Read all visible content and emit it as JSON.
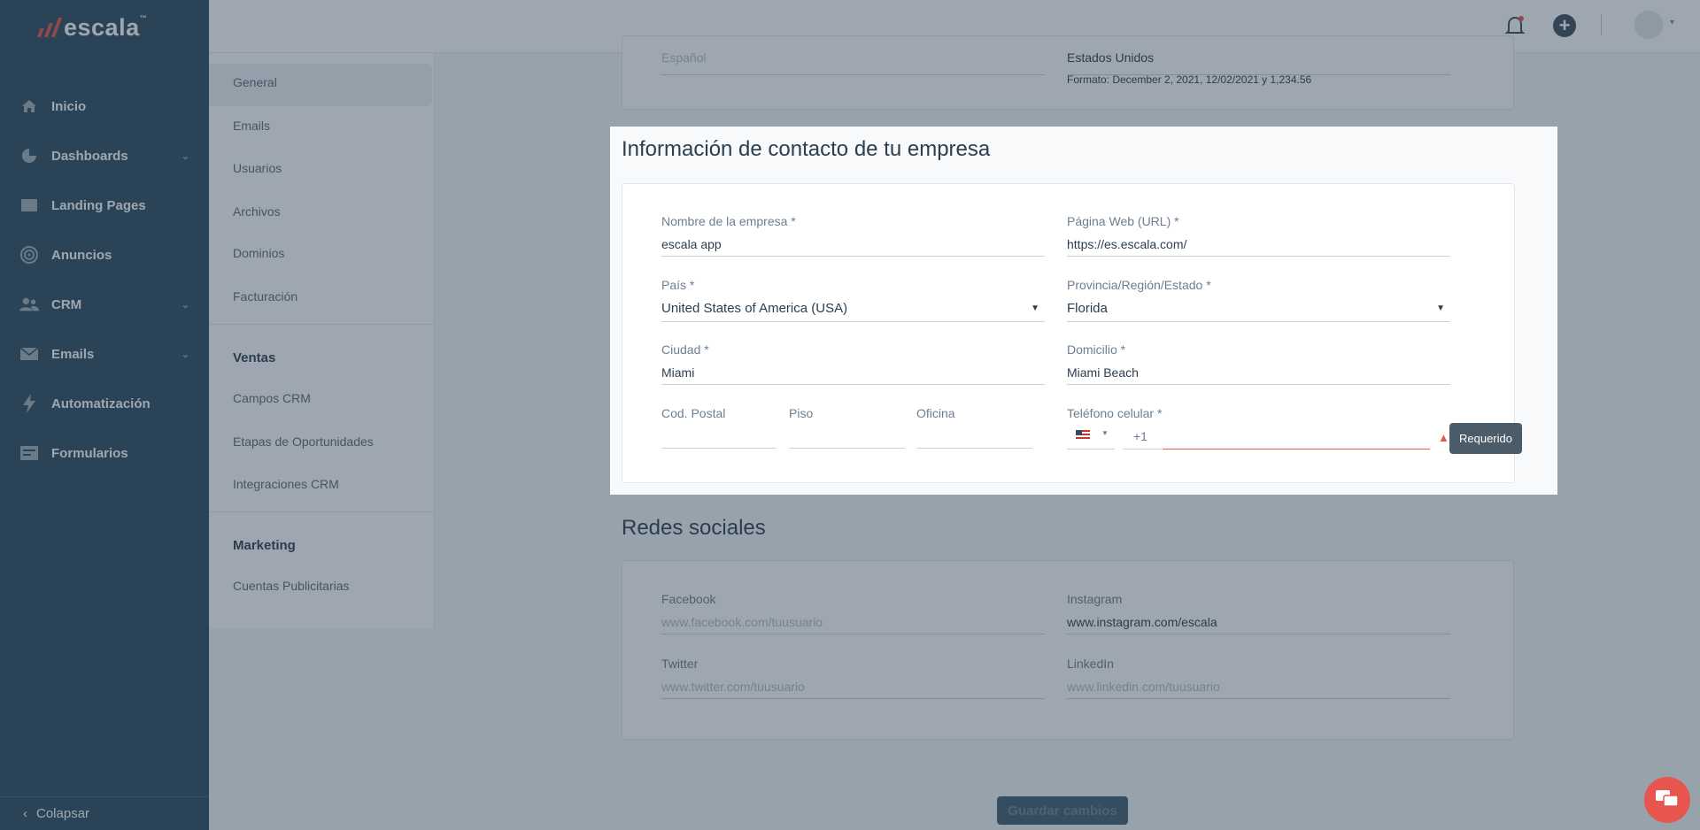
{
  "app": {
    "brand": "escala",
    "brand_tm": "™"
  },
  "sidebar": {
    "items": [
      {
        "label": "Inicio",
        "icon": "home-icon"
      },
      {
        "label": "Dashboards",
        "icon": "pie-chart-icon",
        "has_chevron": true
      },
      {
        "label": "Landing Pages",
        "icon": "browser-icon"
      },
      {
        "label": "Anuncios",
        "icon": "target-icon"
      },
      {
        "label": "CRM",
        "icon": "users-icon",
        "has_chevron": true
      },
      {
        "label": "Emails",
        "icon": "envelope-icon",
        "has_chevron": true
      },
      {
        "label": "Automatización",
        "icon": "bolt-icon"
      },
      {
        "label": "Formularios",
        "icon": "form-icon"
      }
    ],
    "collapse_label": "Colapsar"
  },
  "subnav": {
    "general": [
      "General",
      "Emails",
      "Usuarios",
      "Archivos",
      "Dominios",
      "Facturación"
    ],
    "ventas_heading": "Ventas",
    "ventas": [
      "Campos CRM",
      "Etapas de Oportunidades",
      "Integraciones CRM"
    ],
    "marketing_heading": "Marketing",
    "marketing": [
      "Cuentas Publicitarias"
    ]
  },
  "top_card": {
    "language_value": "Español",
    "country_value": "Estados Unidos",
    "format_note": "Formato: December 2, 2021, 12/02/2021 y 1,234.56"
  },
  "contact": {
    "title": "Información de contacto de tu empresa",
    "company_label": "Nombre de la empresa *",
    "company_value": "escala app",
    "web_label": "Página Web (URL) *",
    "web_value": "https://es.escala.com/",
    "country_label": "País *",
    "country_value": "United States of America (USA)",
    "region_label": "Provincia/Región/Estado *",
    "region_value": "Florida",
    "city_label": "Ciudad *",
    "city_value": "Miami",
    "address_label": "Domicilio *",
    "address_value": "Miami Beach",
    "postal_label": "Cod. Postal",
    "floor_label": "Piso",
    "office_label": "Oficina",
    "phone_label": "Teléfono celular *",
    "phone_code": "+1",
    "tooltip": "Requerido"
  },
  "social": {
    "title": "Redes sociales",
    "facebook_label": "Facebook",
    "facebook_placeholder": "www.facebook.com/tuusuario",
    "instagram_label": "Instagram",
    "instagram_value": "www.instagram.com/escala",
    "twitter_label": "Twitter",
    "twitter_placeholder": "www.twitter.com/tuusuario",
    "linkedin_label": "LinkedIn",
    "linkedin_placeholder": "www.linkedin.com/tuusuario"
  },
  "footer": {
    "save_label": "Guardar cambios"
  },
  "colors": {
    "sidebar": "#2c4a5e",
    "accent": "#e8544e",
    "overlay": "rgba(40,60,78,0.45)"
  }
}
